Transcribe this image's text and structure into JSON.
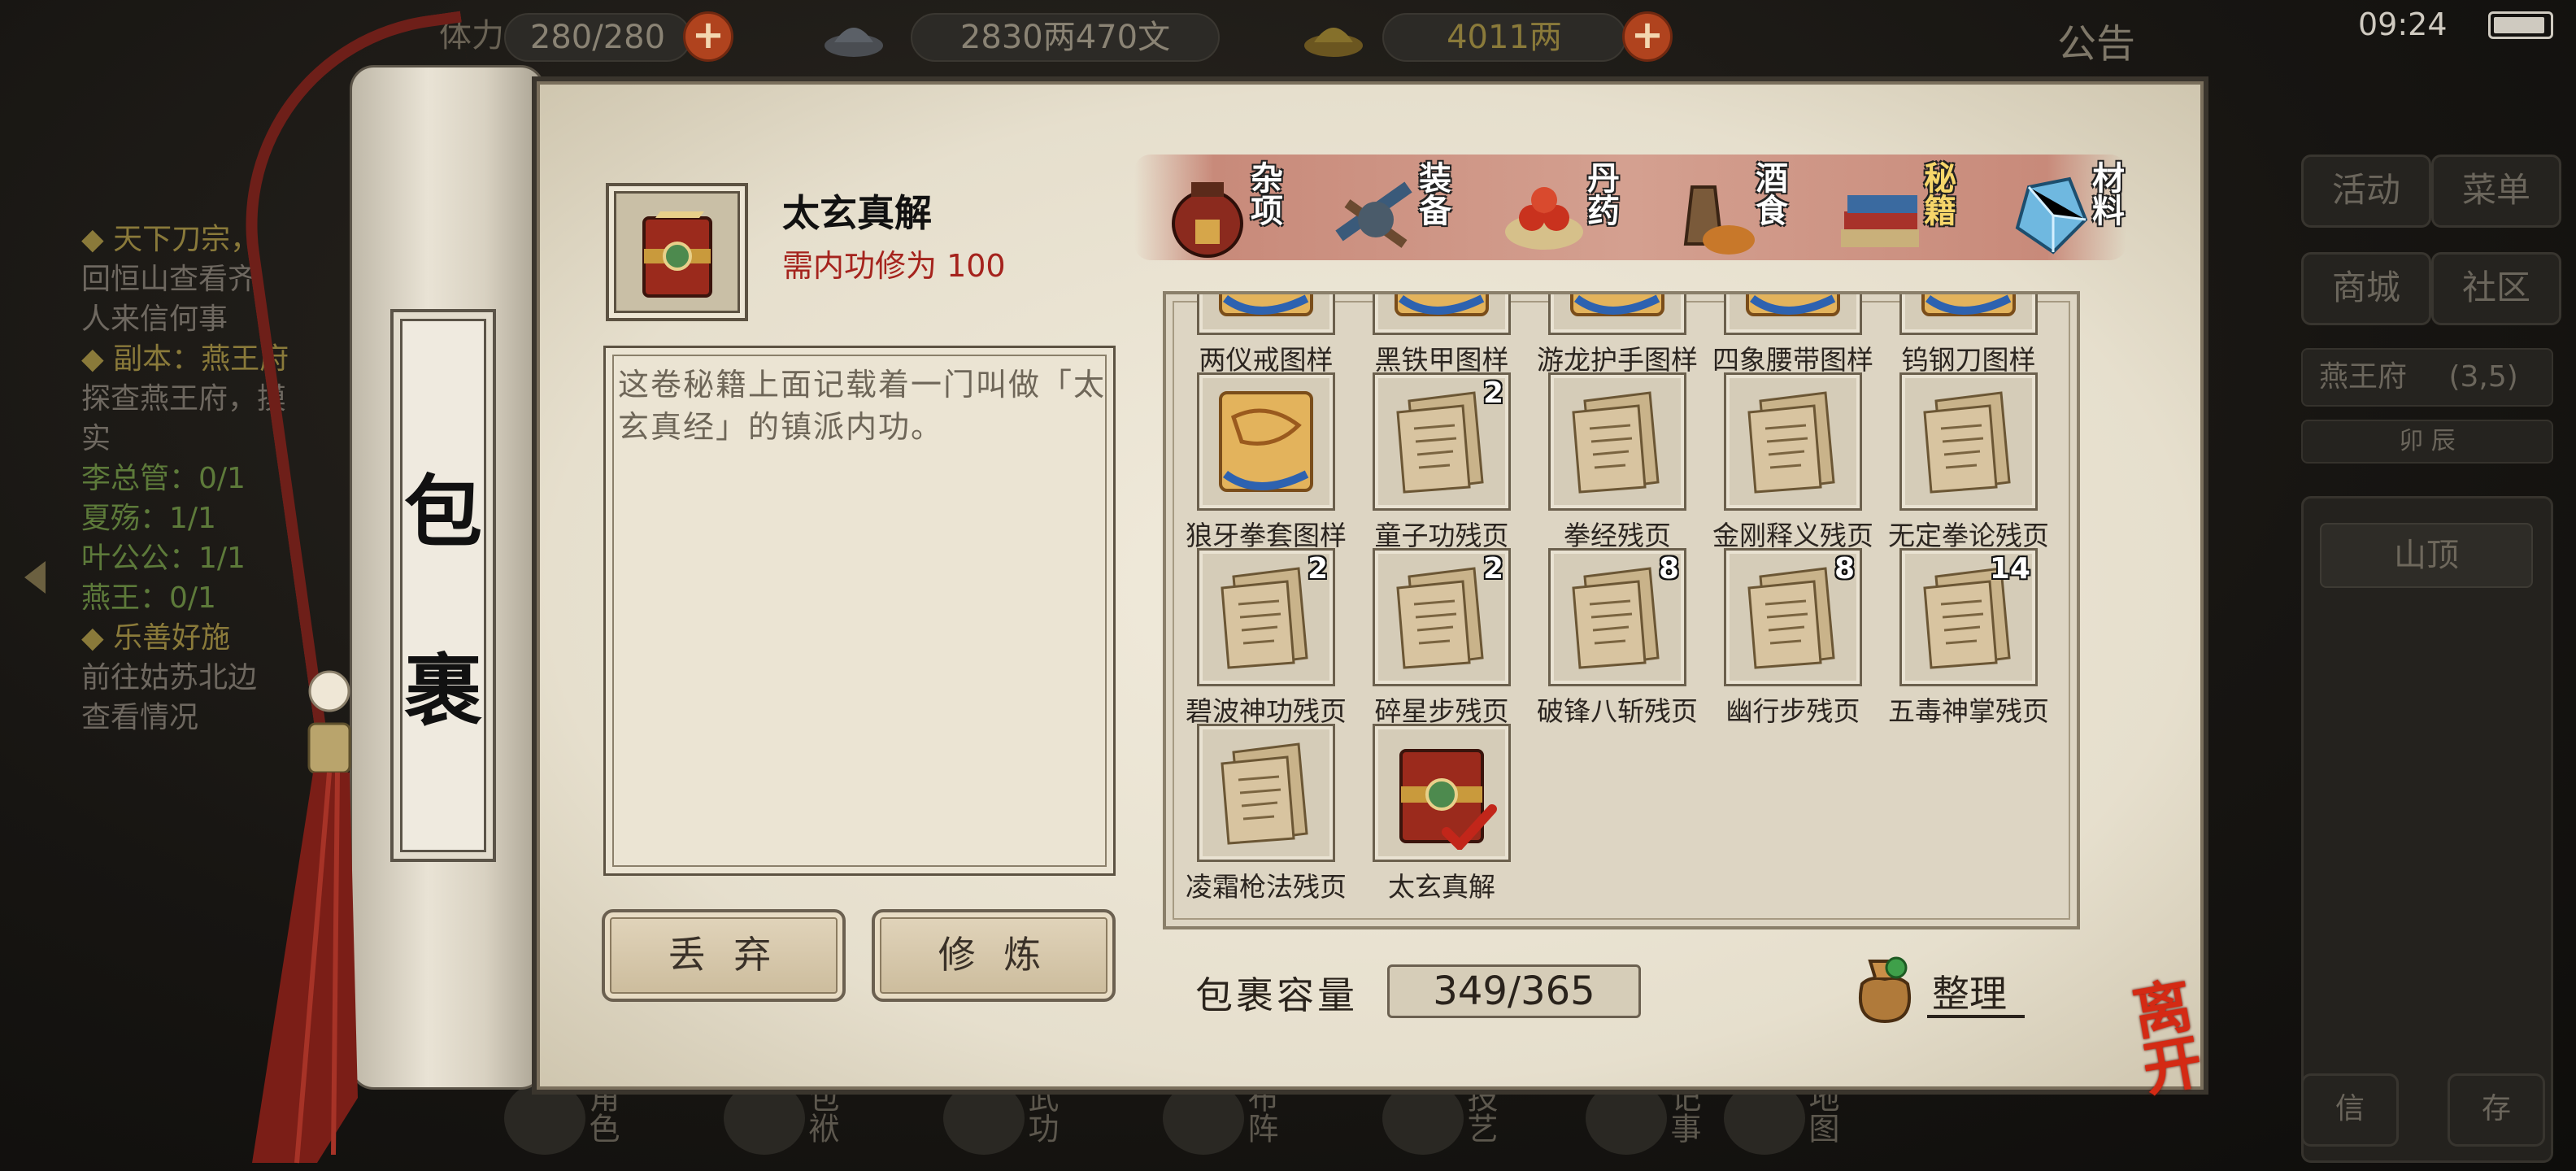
{
  "hud": {
    "stamina_label": "体力",
    "stamina": "280/280",
    "silver": "2830两470文",
    "gold": "4011两",
    "notice": "公告",
    "time": "09:24"
  },
  "right_panel": {
    "activity": "活动",
    "menu": "菜单",
    "shop": "商城",
    "community": "社区",
    "location": "燕王府",
    "location_coord": "(3,5)",
    "time_bar": "卯 辰",
    "peak": "山顶",
    "bottom_left": "信",
    "bottom_right": "存"
  },
  "quests": [
    {
      "title": "◆ 天下刀宗，",
      "lines": [
        "回恒山查看齐",
        "人来信何事"
      ]
    },
    {
      "title": "◆ 副本：燕王府",
      "lines": [
        "探查燕王府，摸",
        "实"
      ]
    },
    {
      "progress": [
        "李总管：0/1",
        "夏殇：1/1",
        "叶公公：1/1",
        "燕王：0/1"
      ]
    },
    {
      "title": "◆ 乐善好施",
      "lines": [
        "前往姑苏北边",
        "查看情况"
      ]
    }
  ],
  "bottom_nav": [
    "角色",
    "包袱",
    "武功",
    "布阵",
    "技艺",
    "记事",
    "地图"
  ],
  "bag": {
    "title": "包裹",
    "selected": {
      "name": "太玄真解",
      "requirement": "需内功修为 100",
      "description": "这卷秘籍上面记载着一门叫做「太玄真经」的镇派内功。"
    },
    "discard": "丢 弃",
    "practice": "修 炼",
    "capacity_label": "包裹容量",
    "capacity": "349/365",
    "sort": "整理",
    "leave": "离开",
    "categories": [
      {
        "label": "杂项",
        "icon": "jar-icon",
        "active": false
      },
      {
        "label": "装备",
        "icon": "equipment-icon",
        "active": false
      },
      {
        "label": "丹药",
        "icon": "pills-icon",
        "active": false
      },
      {
        "label": "酒食",
        "icon": "food-icon",
        "active": false
      },
      {
        "label": "秘籍",
        "icon": "books-icon",
        "active": true
      },
      {
        "label": "材料",
        "icon": "crystal-icon",
        "active": false
      }
    ],
    "items": [
      {
        "name": "两仪戒图样",
        "icon": "pattern-scroll-icon",
        "count": ""
      },
      {
        "name": "黑铁甲图样",
        "icon": "pattern-scroll-icon",
        "count": ""
      },
      {
        "name": "游龙护手图样",
        "icon": "pattern-scroll-icon",
        "count": ""
      },
      {
        "name": "四象腰带图样",
        "icon": "pattern-scroll-icon",
        "count": ""
      },
      {
        "name": "钨钢刀图样",
        "icon": "pattern-scroll-icon",
        "count": ""
      },
      {
        "name": "狼牙拳套图样",
        "icon": "pattern-scroll-icon",
        "count": ""
      },
      {
        "name": "童子功残页",
        "icon": "page-icon",
        "count": "2"
      },
      {
        "name": "拳经残页",
        "icon": "page-icon",
        "count": ""
      },
      {
        "name": "金刚释义残页",
        "icon": "page-icon",
        "count": ""
      },
      {
        "name": "无定拳论残页",
        "icon": "page-icon",
        "count": ""
      },
      {
        "name": "碧波神功残页",
        "icon": "page-icon",
        "count": "2"
      },
      {
        "name": "碎星步残页",
        "icon": "page-icon",
        "count": "2"
      },
      {
        "name": "破锋八斩残页",
        "icon": "page-icon",
        "count": "8"
      },
      {
        "name": "幽行步残页",
        "icon": "page-icon",
        "count": "8"
      },
      {
        "name": "五毒神掌残页",
        "icon": "page-icon",
        "count": "14"
      },
      {
        "name": "凌霜枪法残页",
        "icon": "page-icon",
        "count": ""
      },
      {
        "name": "太玄真解",
        "icon": "book-icon",
        "count": "",
        "selected": true
      }
    ]
  },
  "colors": {
    "paper": "#ebe4d3",
    "requirement_red": "#a5231d",
    "active_tab": "#f6d66a",
    "leave_red": "#d42a14"
  }
}
